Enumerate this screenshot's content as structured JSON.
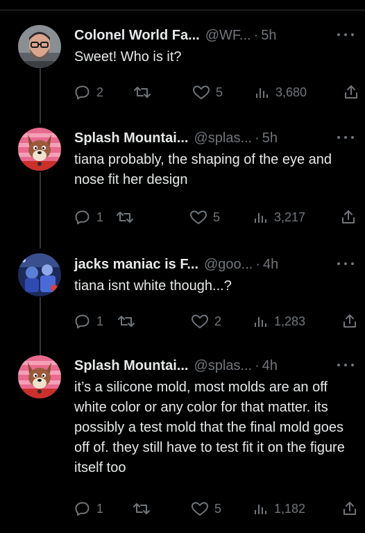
{
  "tweets": [
    {
      "name": "Colonel World Fa...",
      "handle": "@WF...",
      "time": "5h",
      "text": "Sweet! Who is it?",
      "replies": "2",
      "likes": "5",
      "views": "3,680",
      "avatar": "bearded-man-glasses"
    },
    {
      "name": "Splash Mountai...",
      "handle": "@splas...",
      "time": "5h",
      "text": "tiana probably, the shaping of the eye and nose fit her design",
      "replies": "1",
      "likes": "5",
      "views": "3,217",
      "avatar": "brer-fox-cartoon"
    },
    {
      "name": "jacks maniac is F...",
      "handle": "@goo...",
      "time": "4h",
      "text": "tiana isnt white though...?",
      "replies": "1",
      "likes": "2",
      "views": "1,283",
      "avatar": "blue-photo"
    },
    {
      "name": "Splash Mountai...",
      "handle": "@splas...",
      "time": "4h",
      "text": "it’s a silicone mold, most molds are an off white color or any color for that matter. its possibly a test mold that the final mold goes off of. they still have to test fit it on the figure itself too",
      "replies": "1",
      "likes": "5",
      "views": "1,182",
      "avatar": "brer-fox-cartoon"
    }
  ],
  "colors": {
    "background": "#000000",
    "text": "#e7e9ea",
    "muted": "#71767b",
    "thread_line": "#333639"
  },
  "separator": "·"
}
